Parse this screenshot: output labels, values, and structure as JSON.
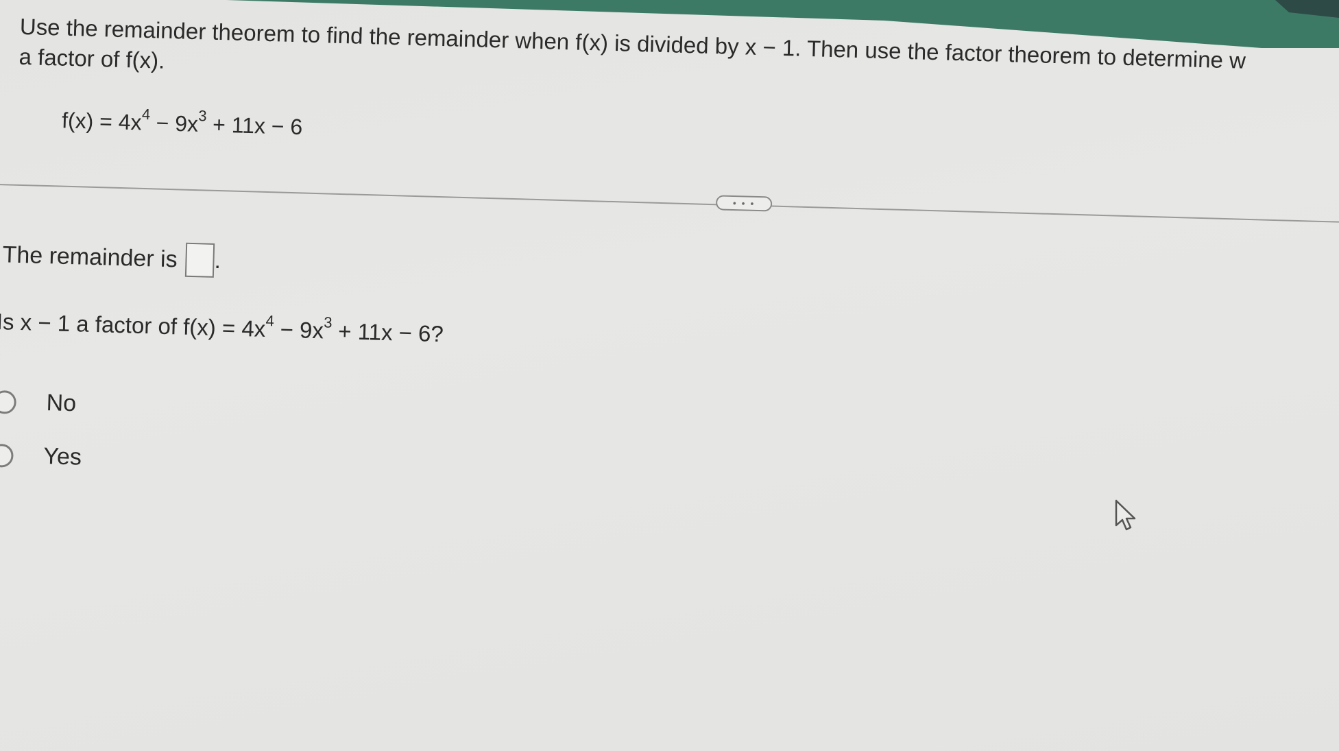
{
  "question": {
    "line1": "Use the remainder theorem to find the remainder when f(x) is divided by x − 1. Then use the factor theorem to determine w",
    "line2": "a factor of f(x)."
  },
  "equation": {
    "prefix": "f(x) = 4x",
    "exp1": "4",
    "mid": " − 9x",
    "exp2": "3",
    "suffix": " + 11x − 6"
  },
  "more_button": {
    "label": "• • •"
  },
  "remainder": {
    "label": "The remainder is",
    "value": "",
    "trailing": "."
  },
  "factor_question": {
    "prefix": "Is x − 1 a factor of f(x) = 4x",
    "exp1": "4",
    "mid": " − 9x",
    "exp2": "3",
    "suffix": " + 11x − 6?"
  },
  "options": [
    {
      "label": "No",
      "selected": false
    },
    {
      "label": "Yes",
      "selected": false
    }
  ],
  "colors": {
    "background": "#e6e6e4",
    "top_band": "#3d7a66",
    "text": "#2a2a2a"
  }
}
